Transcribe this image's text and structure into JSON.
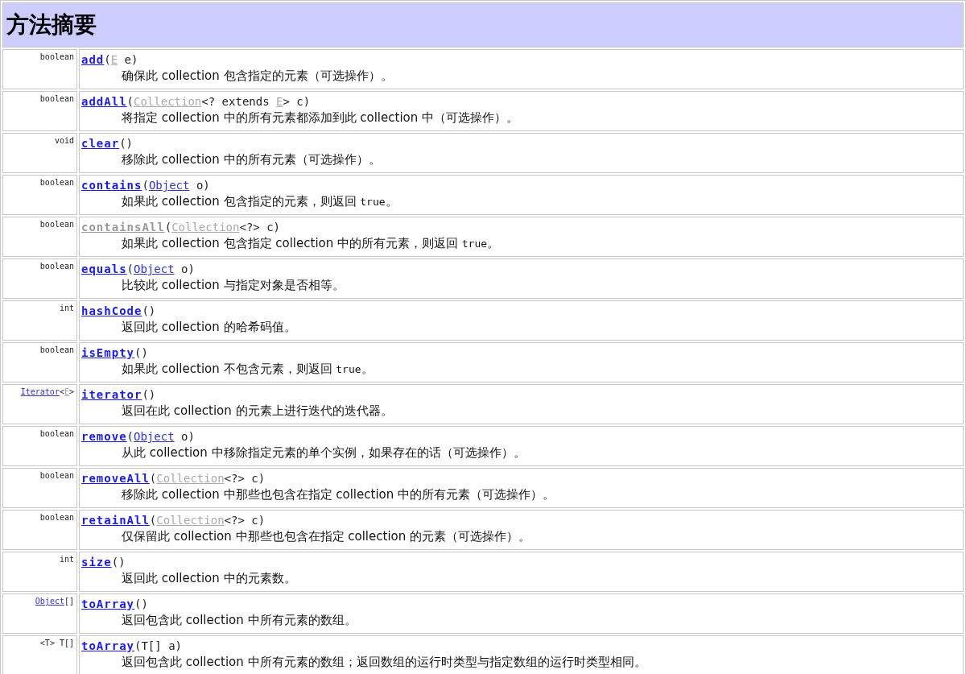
{
  "title": "方法摘要",
  "methods": [
    {
      "returns": [
        {
          "kind": "plain",
          "text": "boolean"
        }
      ],
      "name": {
        "text": "add",
        "visited": false
      },
      "params": [
        {
          "kind": "plain",
          "text": "("
        },
        {
          "kind": "link",
          "text": "E",
          "visited": true
        },
        {
          "kind": "plain",
          "text": " e)"
        }
      ],
      "description": [
        {
          "kind": "text",
          "text": "确保此 collection 包含指定的元素（可选操作）。"
        }
      ]
    },
    {
      "returns": [
        {
          "kind": "plain",
          "text": "boolean"
        }
      ],
      "name": {
        "text": "addAll",
        "visited": false
      },
      "params": [
        {
          "kind": "plain",
          "text": "("
        },
        {
          "kind": "link",
          "text": "Collection",
          "visited": true
        },
        {
          "kind": "plain",
          "text": "<? extends "
        },
        {
          "kind": "link",
          "text": "E",
          "visited": true
        },
        {
          "kind": "plain",
          "text": "> c)"
        }
      ],
      "description": [
        {
          "kind": "text",
          "text": "将指定 collection 中的所有元素都添加到此 collection 中（可选操作）。"
        }
      ]
    },
    {
      "returns": [
        {
          "kind": "plain",
          "text": "void"
        }
      ],
      "name": {
        "text": "clear",
        "visited": false
      },
      "params": [
        {
          "kind": "plain",
          "text": "()"
        }
      ],
      "description": [
        {
          "kind": "text",
          "text": "移除此 collection 中的所有元素（可选操作）。"
        }
      ]
    },
    {
      "returns": [
        {
          "kind": "plain",
          "text": "boolean"
        }
      ],
      "name": {
        "text": "contains",
        "visited": false
      },
      "params": [
        {
          "kind": "plain",
          "text": "("
        },
        {
          "kind": "link",
          "text": "Object",
          "visited": false
        },
        {
          "kind": "plain",
          "text": " o)"
        }
      ],
      "description": [
        {
          "kind": "text",
          "text": "如果此 collection 包含指定的元素，则返回 "
        },
        {
          "kind": "code",
          "text": "true"
        },
        {
          "kind": "text",
          "text": "。"
        }
      ]
    },
    {
      "returns": [
        {
          "kind": "plain",
          "text": "boolean"
        }
      ],
      "name": {
        "text": "containsAll",
        "visited": true
      },
      "params": [
        {
          "kind": "plain",
          "text": "("
        },
        {
          "kind": "link",
          "text": "Collection",
          "visited": true
        },
        {
          "kind": "plain",
          "text": "<?> c)"
        }
      ],
      "description": [
        {
          "kind": "text",
          "text": "如果此 collection 包含指定 collection 中的所有元素，则返回 "
        },
        {
          "kind": "code",
          "text": "true"
        },
        {
          "kind": "text",
          "text": "。"
        }
      ]
    },
    {
      "returns": [
        {
          "kind": "plain",
          "text": "boolean"
        }
      ],
      "name": {
        "text": "equals",
        "visited": false
      },
      "params": [
        {
          "kind": "plain",
          "text": "("
        },
        {
          "kind": "link",
          "text": "Object",
          "visited": false
        },
        {
          "kind": "plain",
          "text": " o)"
        }
      ],
      "description": [
        {
          "kind": "text",
          "text": "比较此 collection 与指定对象是否相等。"
        }
      ]
    },
    {
      "returns": [
        {
          "kind": "plain",
          "text": "int"
        }
      ],
      "name": {
        "text": "hashCode",
        "visited": false
      },
      "params": [
        {
          "kind": "plain",
          "text": "()"
        }
      ],
      "description": [
        {
          "kind": "text",
          "text": "返回此 collection 的哈希码值。"
        }
      ]
    },
    {
      "returns": [
        {
          "kind": "plain",
          "text": "boolean"
        }
      ],
      "name": {
        "text": "isEmpty",
        "visited": false
      },
      "params": [
        {
          "kind": "plain",
          "text": "()"
        }
      ],
      "description": [
        {
          "kind": "text",
          "text": "如果此 collection 不包含元素，则返回 "
        },
        {
          "kind": "code",
          "text": "true"
        },
        {
          "kind": "text",
          "text": "。"
        }
      ]
    },
    {
      "returns": [
        {
          "kind": "link",
          "text": "Iterator",
          "visited": false
        },
        {
          "kind": "plain",
          "text": "<"
        },
        {
          "kind": "link",
          "text": "E",
          "visited": true
        },
        {
          "kind": "plain",
          "text": ">"
        }
      ],
      "name": {
        "text": "iterator",
        "visited": false
      },
      "params": [
        {
          "kind": "plain",
          "text": "()"
        }
      ],
      "description": [
        {
          "kind": "text",
          "text": "返回在此 collection 的元素上进行迭代的迭代器。"
        }
      ]
    },
    {
      "returns": [
        {
          "kind": "plain",
          "text": "boolean"
        }
      ],
      "name": {
        "text": "remove",
        "visited": false
      },
      "params": [
        {
          "kind": "plain",
          "text": "("
        },
        {
          "kind": "link",
          "text": "Object",
          "visited": false
        },
        {
          "kind": "plain",
          "text": " o)"
        }
      ],
      "description": [
        {
          "kind": "text",
          "text": "从此 collection 中移除指定元素的单个实例，如果存在的话（可选操作）。"
        }
      ]
    },
    {
      "returns": [
        {
          "kind": "plain",
          "text": "boolean"
        }
      ],
      "name": {
        "text": "removeAll",
        "visited": false
      },
      "params": [
        {
          "kind": "plain",
          "text": "("
        },
        {
          "kind": "link",
          "text": "Collection",
          "visited": true
        },
        {
          "kind": "plain",
          "text": "<?> c)"
        }
      ],
      "description": [
        {
          "kind": "text",
          "text": "移除此 collection 中那些也包含在指定 collection 中的所有元素（可选操作）。"
        }
      ]
    },
    {
      "returns": [
        {
          "kind": "plain",
          "text": "boolean"
        }
      ],
      "name": {
        "text": "retainAll",
        "visited": false
      },
      "params": [
        {
          "kind": "plain",
          "text": "("
        },
        {
          "kind": "link",
          "text": "Collection",
          "visited": true
        },
        {
          "kind": "plain",
          "text": "<?> c)"
        }
      ],
      "description": [
        {
          "kind": "text",
          "text": "仅保留此 collection 中那些也包含在指定 collection 的元素（可选操作）。"
        }
      ]
    },
    {
      "returns": [
        {
          "kind": "plain",
          "text": "int"
        }
      ],
      "name": {
        "text": "size",
        "visited": false
      },
      "params": [
        {
          "kind": "plain",
          "text": "()"
        }
      ],
      "description": [
        {
          "kind": "text",
          "text": "返回此 collection 中的元素数。"
        }
      ]
    },
    {
      "returns": [
        {
          "kind": "link",
          "text": "Object",
          "visited": false
        },
        {
          "kind": "plain",
          "text": "[]"
        }
      ],
      "name": {
        "text": "toArray",
        "visited": false
      },
      "params": [
        {
          "kind": "plain",
          "text": "()"
        }
      ],
      "description": [
        {
          "kind": "text",
          "text": "返回包含此 collection 中所有元素的数组。"
        }
      ]
    },
    {
      "returns": [
        {
          "kind": "plain",
          "text": "<T> T[]"
        }
      ],
      "name": {
        "text": "toArray",
        "visited": false
      },
      "params": [
        {
          "kind": "plain",
          "text": "(T[] a)"
        }
      ],
      "description": [
        {
          "kind": "text",
          "text": "返回包含此 collection 中所有元素的数组；返回数组的运行时类型与指定数组的运行时类型相同。"
        }
      ]
    }
  ]
}
